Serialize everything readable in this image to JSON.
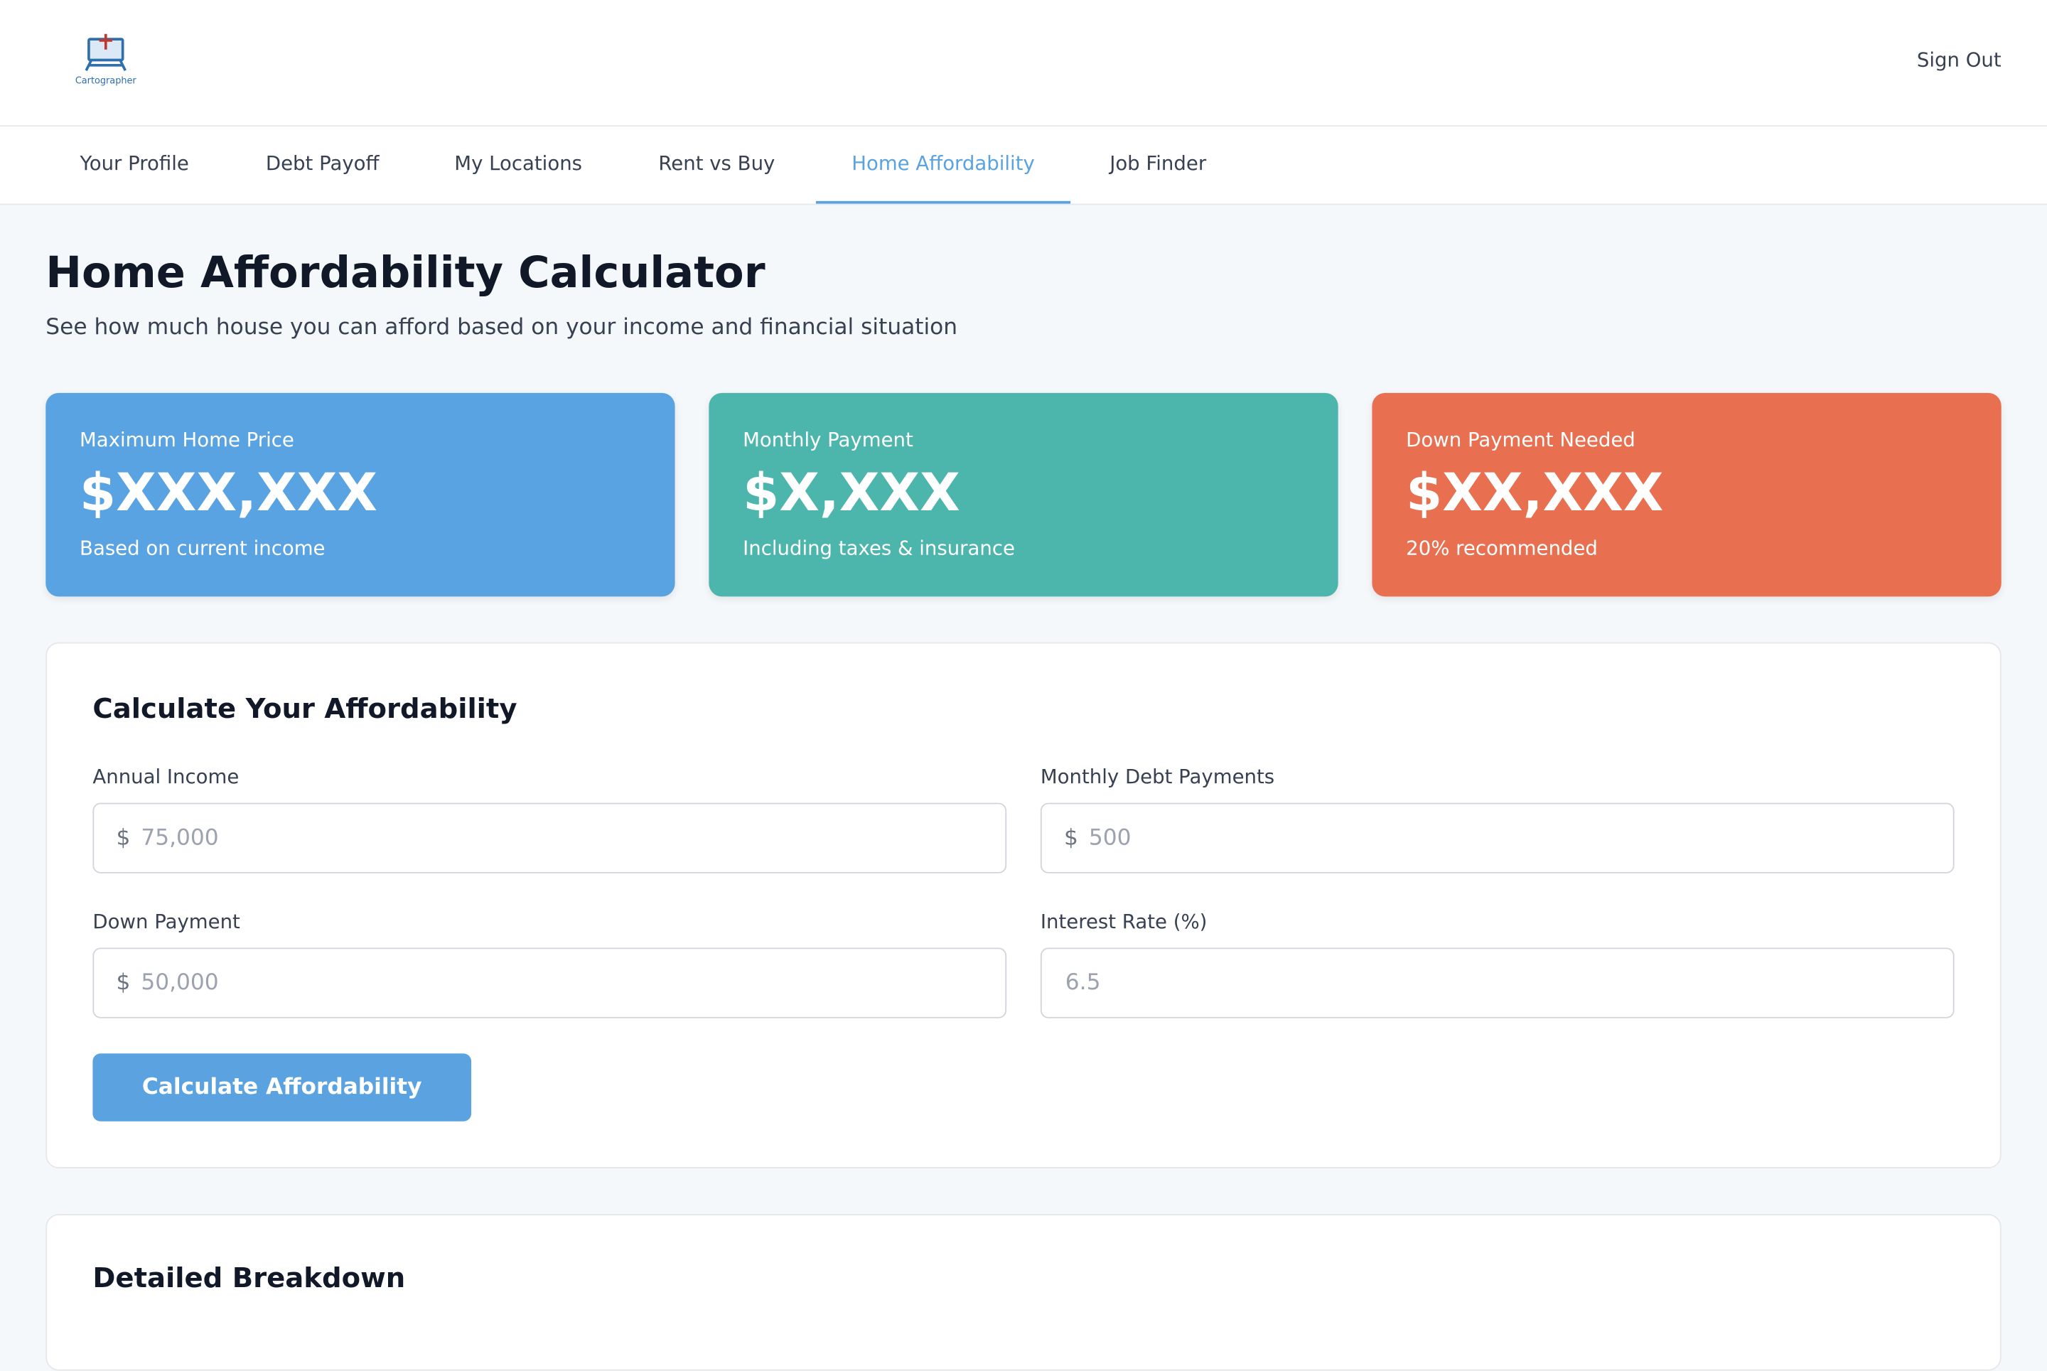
{
  "app": {
    "logo_text": "Cartographer",
    "sign_out_label": "Sign Out"
  },
  "nav": {
    "tabs": [
      {
        "label": "Your Profile",
        "active": false
      },
      {
        "label": "Debt Payoff",
        "active": false
      },
      {
        "label": "My Locations",
        "active": false
      },
      {
        "label": "Rent vs Buy",
        "active": false
      },
      {
        "label": "Home Affordability",
        "active": true
      },
      {
        "label": "Job Finder",
        "active": false
      }
    ]
  },
  "page": {
    "title": "Home Affordability Calculator",
    "subtitle": "See how much house you can afford based on your income and financial situation"
  },
  "stats": [
    {
      "label": "Maximum Home Price",
      "value": "$XXX,XXX",
      "note": "Based on current income",
      "color": "#5aa3e3"
    },
    {
      "label": "Monthly Payment",
      "value": "$X,XXX",
      "note": "Including taxes & insurance",
      "color": "#4db6ac"
    },
    {
      "label": "Down Payment Needed",
      "value": "$XX,XXX",
      "note": "20% recommended",
      "color": "#e87050"
    }
  ],
  "calculator": {
    "title": "Calculate Your Affordability",
    "fields": {
      "annual_income": {
        "label": "Annual Income",
        "prefix": "$",
        "placeholder": "75,000",
        "value": ""
      },
      "monthly_debt": {
        "label": "Monthly Debt Payments",
        "prefix": "$",
        "placeholder": "500",
        "value": ""
      },
      "down_payment": {
        "label": "Down Payment",
        "prefix": "$",
        "placeholder": "50,000",
        "value": ""
      },
      "interest_rate": {
        "label": "Interest Rate (%)",
        "placeholder": "6.5",
        "value": ""
      }
    },
    "button_label": "Calculate Affordability"
  },
  "breakdown": {
    "title": "Detailed Breakdown"
  },
  "colors": {
    "accent": "#5aa3e0",
    "page_bg": "#f5f8fb"
  }
}
